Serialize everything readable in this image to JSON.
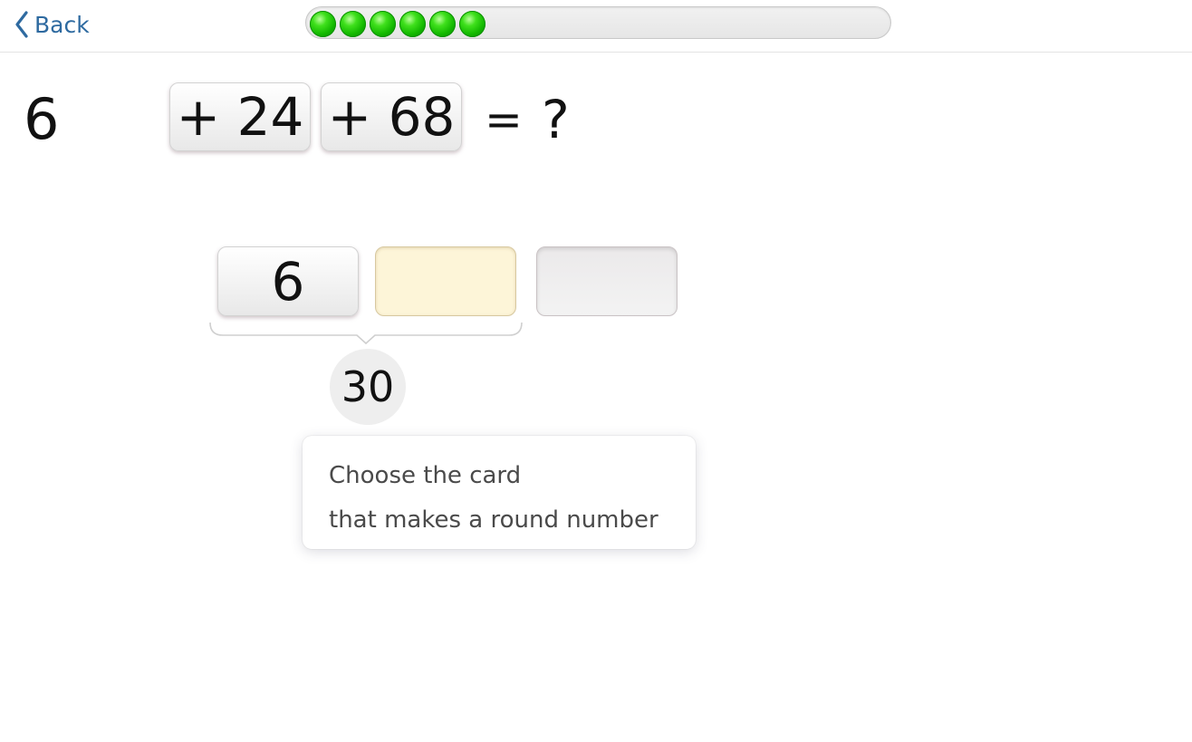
{
  "header": {
    "back_label": "Back",
    "progress": {
      "completed_steps": 6
    }
  },
  "equation": {
    "start_number": "6",
    "terms": [
      "+ 24",
      "+ 68"
    ],
    "equals": "=",
    "unknown": "?"
  },
  "slots": [
    "6",
    "",
    ""
  ],
  "partial_sum": "30",
  "hint": {
    "line1": "Choose the card",
    "line2": "that makes a round number"
  },
  "colors": {
    "accent_link": "#2e6aa0",
    "progress_dot": "#13b800",
    "target_slot": "#fdf5d8"
  }
}
